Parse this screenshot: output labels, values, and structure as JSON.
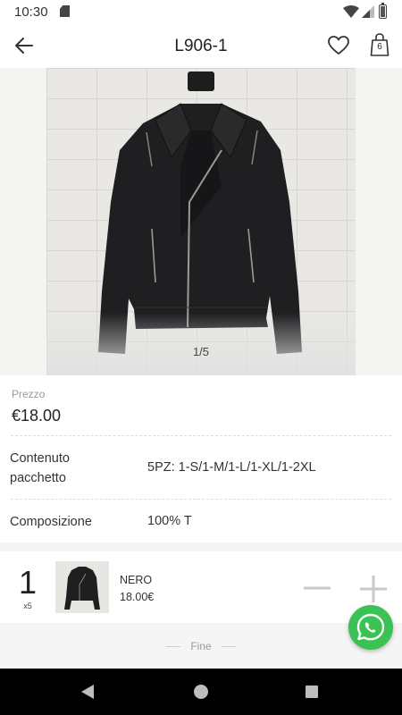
{
  "status_bar": {
    "time": "10:30"
  },
  "header": {
    "title": "L906-1",
    "cart_count": "6"
  },
  "gallery": {
    "page_indicator": "1/5"
  },
  "details": {
    "price_label": "Prezzo",
    "price": "€18.00",
    "package_label_line1": "Contenuto",
    "package_label_line2": "pacchetto",
    "package_value": "5PZ: 1-S/1-M/1-L/1-XL/1-2XL",
    "composition_label": "Composizione",
    "composition_value": "100% T"
  },
  "variant": {
    "quantity": "1",
    "multiplier": "x5",
    "color": "NERO",
    "price": "18.00€"
  },
  "footer": {
    "end_label": "Fine"
  },
  "colors": {
    "whatsapp": "#3ac254",
    "nav_bar": "#000000"
  },
  "icons": [
    "back-arrow-icon",
    "heart-icon",
    "shopping-bag-icon",
    "minus-icon",
    "plus-icon",
    "whatsapp-icon",
    "wifi-icon",
    "signal-icon",
    "battery-icon",
    "sd-card-icon"
  ]
}
